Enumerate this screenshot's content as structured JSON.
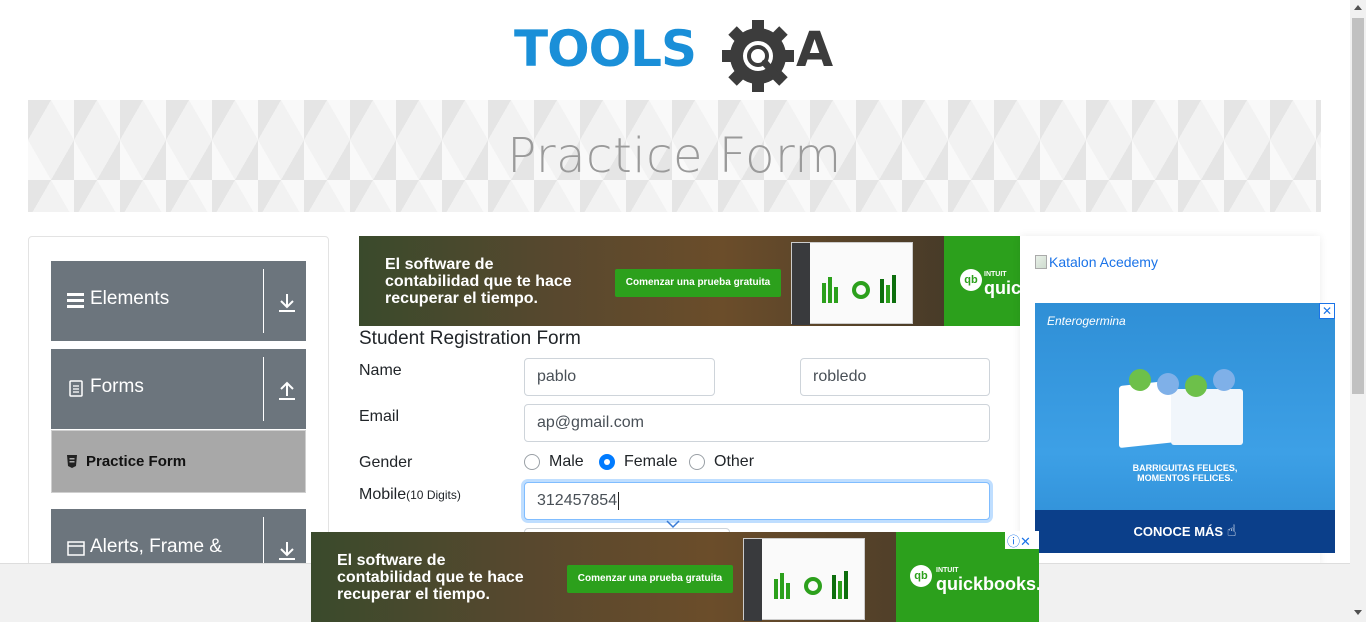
{
  "logo": {
    "text_left": "TOOLS",
    "text_right": "A"
  },
  "banner": {
    "title": "Practice Form"
  },
  "sidebar": {
    "groups": [
      {
        "label": "Elements",
        "icon": "hamburger-icon",
        "arrow": "download-arrow-icon"
      },
      {
        "label": "Forms",
        "icon": "document-icon",
        "arrow": "upload-arrow-icon"
      },
      {
        "label": "Alerts, Frame &",
        "icon": "window-icon",
        "arrow": "download-arrow-icon"
      }
    ],
    "active_item": {
      "label": "Practice Form",
      "icon": "html-icon"
    }
  },
  "top_ad": {
    "line1": "El software de",
    "line2": "contabilidad que te hace",
    "line3": "recuperar el tiempo.",
    "cta": "Comenzar una prueba gratuita",
    "brand_small": "INTUIT",
    "brand": "quickbooks",
    "brand_badge": "qb",
    "colors": {
      "green": "#2ca01c"
    }
  },
  "bottom_ad": {
    "line1": "El software de",
    "line2": "contabilidad que te hace",
    "line3": "recuperar el tiempo.",
    "cta": "Comenzar una prueba gratuita",
    "brand_small": "INTUIT",
    "brand": "quickbooks.",
    "brand_badge": "qb",
    "close_glyphs": "ⓘ✕"
  },
  "form": {
    "title": "Student Registration Form",
    "name_label": "Name",
    "first_name": "pablo",
    "last_name": "robledo",
    "email_label": "Email",
    "email": "ap@gmail.com",
    "gender_label": "Gender",
    "gender_options": [
      "Male",
      "Female",
      "Other"
    ],
    "gender_selected": "Female",
    "mobile_label": "Mobile",
    "mobile_hint": "(10 Digits)",
    "mobile": "312457854"
  },
  "right": {
    "katalon_alt": "Katalon Acedemy",
    "ent_brand": "Enterogermina",
    "ent_tagline1": "BARRIGUITAS FELICES,",
    "ent_tagline2": "MOMENTOS FELICES.",
    "ent_cta": "CONOCE MÁS",
    "ent_close": "✕",
    "colors": {
      "ad_blue": "#3da0e6",
      "cta_blue": "#0b3f8a"
    }
  },
  "colors": {
    "sidebar_group": "#6c757d",
    "active_item": "#a8a8a8",
    "logo_blue": "#1a8fd8",
    "logo_dark": "#3c3c3c",
    "focus_ring": "#80bdff",
    "radio_on": "#007bff"
  }
}
